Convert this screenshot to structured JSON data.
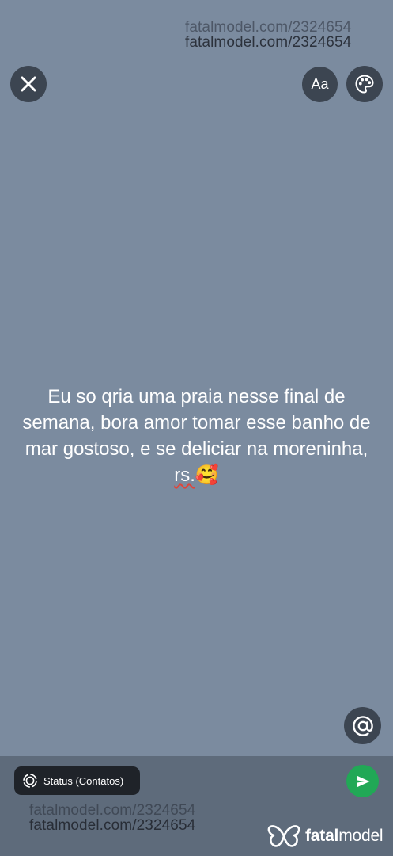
{
  "watermark": {
    "top_line_1": "fatalmodel.com/2324654",
    "top_line_2": "fatalmodel.com/2324654",
    "bottom_line_1": "fatalmodel.com/2324654",
    "bottom_line_2": "fatalmodel.com/2324654"
  },
  "toolbar": {
    "close_icon": "close-icon",
    "text_style_label": "Aa",
    "palette_icon": "palette-icon"
  },
  "status": {
    "text_main": "Eu so qria uma praia nesse final de semana, bora amor tomar esse banho de mar gostoso, e se deliciar na moreninha, ",
    "text_flagged": "rs.",
    "emoji": "🥰",
    "background_color": "#7b8b9f"
  },
  "mention_icon": "at-sign-icon",
  "footer": {
    "privacy_label": "Status (Contatos)",
    "privacy_icon": "status-ring-icon",
    "send_icon": "send-icon",
    "send_color": "#21a856"
  },
  "brand": {
    "part1": "fatal",
    "part2": "model",
    "logo": "butterfly-logo"
  }
}
